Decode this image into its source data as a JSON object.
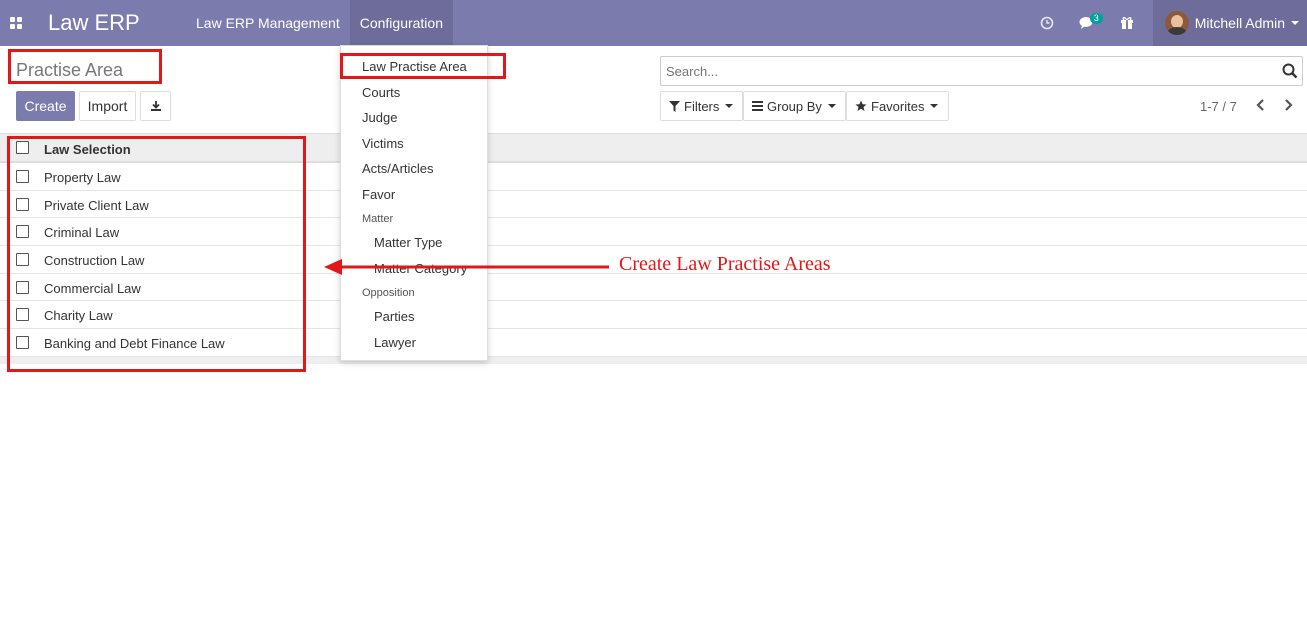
{
  "navbar": {
    "brand": "Law ERP",
    "menu": [
      {
        "label": "Law ERP Management"
      },
      {
        "label": "Configuration"
      }
    ],
    "messages_badge": "3",
    "user_name": "Mitchell Admin"
  },
  "page": {
    "title": "Practise Area",
    "create_label": "Create",
    "import_label": "Import"
  },
  "search": {
    "placeholder": "Search..."
  },
  "filters": {
    "filters_label": "Filters",
    "groupby_label": "Group By",
    "favorites_label": "Favorites"
  },
  "pager": {
    "text": "1-7 / 7"
  },
  "table": {
    "header": "Law Selection",
    "rows": [
      "Property Law",
      "Private Client Law",
      "Criminal Law",
      "Construction Law",
      "Commercial Law",
      "Charity Law",
      "Banking and Debt Finance Law"
    ]
  },
  "dropdown": {
    "items": [
      "Law Practise Area",
      "Courts",
      "Judge",
      "Victims",
      "Acts/Articles",
      "Favor"
    ],
    "matter_header": "Matter",
    "matter_items": [
      "Matter Type",
      "Matter Category"
    ],
    "opposition_header": "Opposition",
    "opposition_items": [
      "Parties",
      "Lawyer"
    ]
  },
  "annotation": {
    "text": "Create Law Practise Areas"
  },
  "colors": {
    "navbar": "#7c7bad",
    "highlight": "#e01818",
    "badge": "#00a09d"
  }
}
